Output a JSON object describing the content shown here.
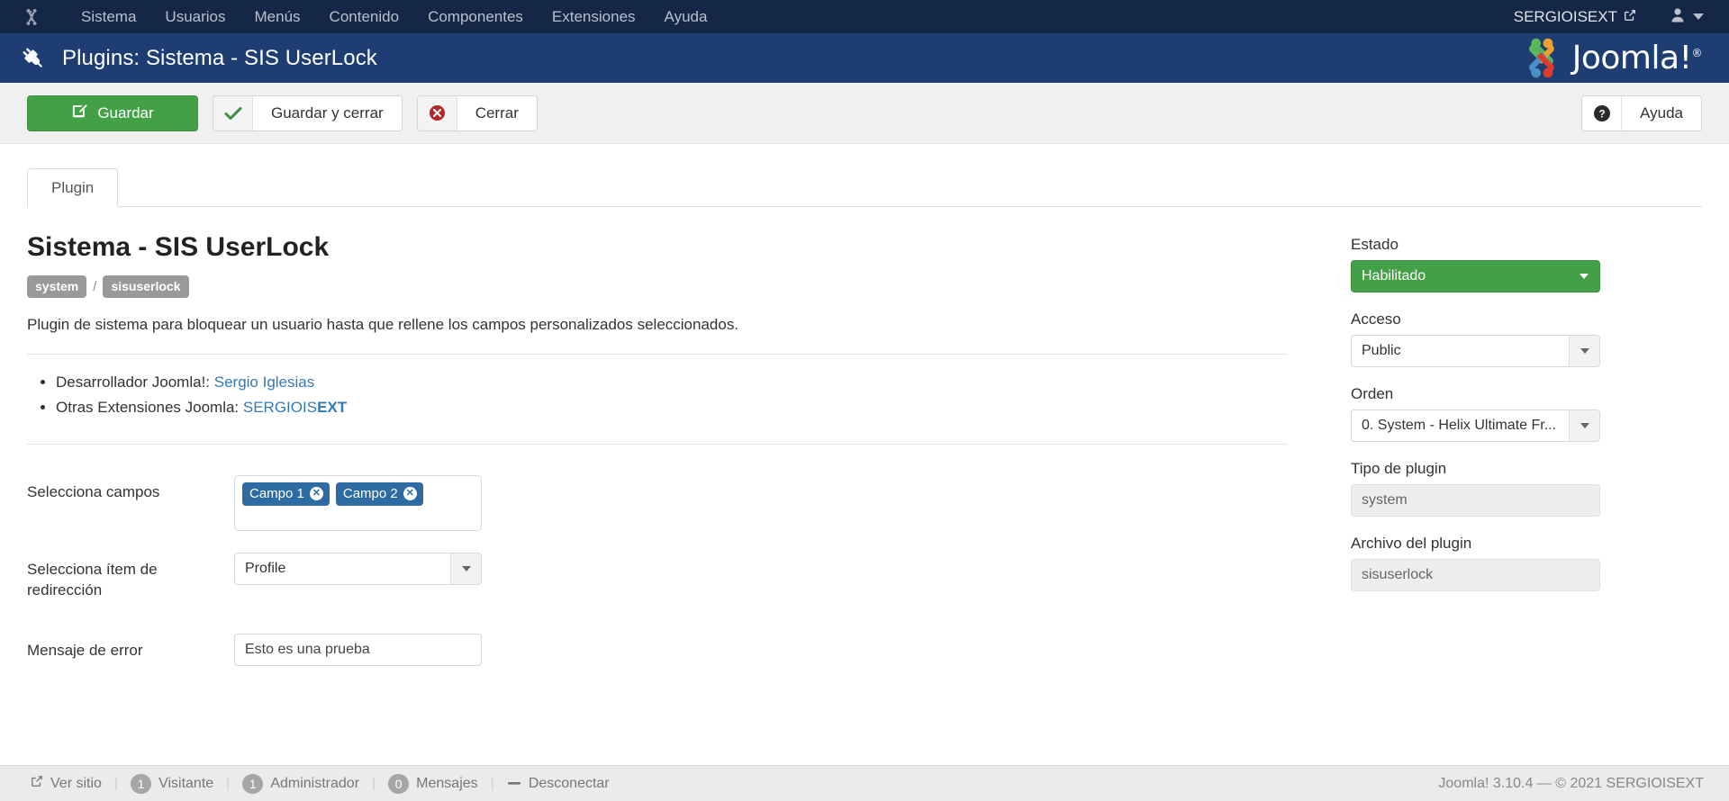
{
  "topnav": {
    "brand_icon": "joomla-mark-icon",
    "items": [
      {
        "label": "Sistema"
      },
      {
        "label": "Usuarios"
      },
      {
        "label": "Menús"
      },
      {
        "label": "Contenido"
      },
      {
        "label": "Componentes"
      },
      {
        "label": "Extensiones"
      },
      {
        "label": "Ayuda"
      }
    ],
    "site_name": "SERGIOISEXT",
    "site_link_icon": "external-link-icon",
    "user_icon": "user-icon",
    "user_caret_icon": "chevron-down-icon"
  },
  "subhead": {
    "icon": "plug-icon",
    "title": "Plugins: Sistema - SIS UserLock",
    "logo_text": "Joomla!",
    "logo_sup": "®"
  },
  "toolbar": {
    "save_label": "Guardar",
    "save_icon": "save-pencil-icon",
    "save_close_label": "Guardar y cerrar",
    "save_close_icon": "check-icon",
    "close_label": "Cerrar",
    "close_icon": "cancel-circle-icon",
    "help_label": "Ayuda",
    "help_icon": "question-circle-icon"
  },
  "tabs": [
    {
      "label": "Plugin",
      "active": true
    }
  ],
  "main": {
    "heading": "Sistema - SIS UserLock",
    "badges": {
      "group": "system",
      "separator": "/",
      "name": "sisuserlock"
    },
    "description": "Plugin de sistema para bloquear un usuario hasta que rellene los campos personalizados seleccionados.",
    "links": [
      {
        "prefix": "Desarrollador Joomla!: ",
        "link_text": "Sergio Iglesias",
        "link_bold": ""
      },
      {
        "prefix": "Otras Extensiones Joomla: ",
        "link_text": "SERGIOIS",
        "link_bold": "EXT"
      }
    ],
    "fields": {
      "select_fields": {
        "label": "Selecciona campos",
        "chips": [
          {
            "label": "Campo 1",
            "remove_icon": "remove-circle-icon"
          },
          {
            "label": "Campo 2",
            "remove_icon": "remove-circle-icon"
          }
        ]
      },
      "redirect_item": {
        "label": "Selecciona ítem de redirección",
        "value": "Profile",
        "caret_icon": "chevron-down-icon"
      },
      "error_message": {
        "label": "Mensaje de error",
        "value": "Esto es una prueba",
        "placeholder": ""
      }
    }
  },
  "sidebar": {
    "status": {
      "label": "Estado",
      "value": "Habilitado",
      "color": "#44a047",
      "caret_icon": "chevron-down-icon"
    },
    "access": {
      "label": "Acceso",
      "value": "Public",
      "caret_icon": "chevron-down-icon"
    },
    "ordering": {
      "label": "Orden",
      "value": "0. System - Helix Ultimate Fr...",
      "caret_icon": "chevron-down-icon"
    },
    "plugin_type": {
      "label": "Tipo de plugin",
      "value": "system"
    },
    "plugin_file": {
      "label": "Archivo del plugin",
      "value": "sisuserlock"
    }
  },
  "footer": {
    "view_site": {
      "label": "Ver sitio",
      "icon": "external-link-icon"
    },
    "visitors": {
      "count": "1",
      "label": "Visitante"
    },
    "admins": {
      "count": "1",
      "label": "Administrador"
    },
    "messages": {
      "count": "0",
      "label": "Mensajes"
    },
    "logout": {
      "label": "Desconectar",
      "icon": "logout-icon"
    },
    "separator": "|",
    "copyright": "Joomla! 3.10.4  —  © 2021 SERGIOISEXT"
  }
}
